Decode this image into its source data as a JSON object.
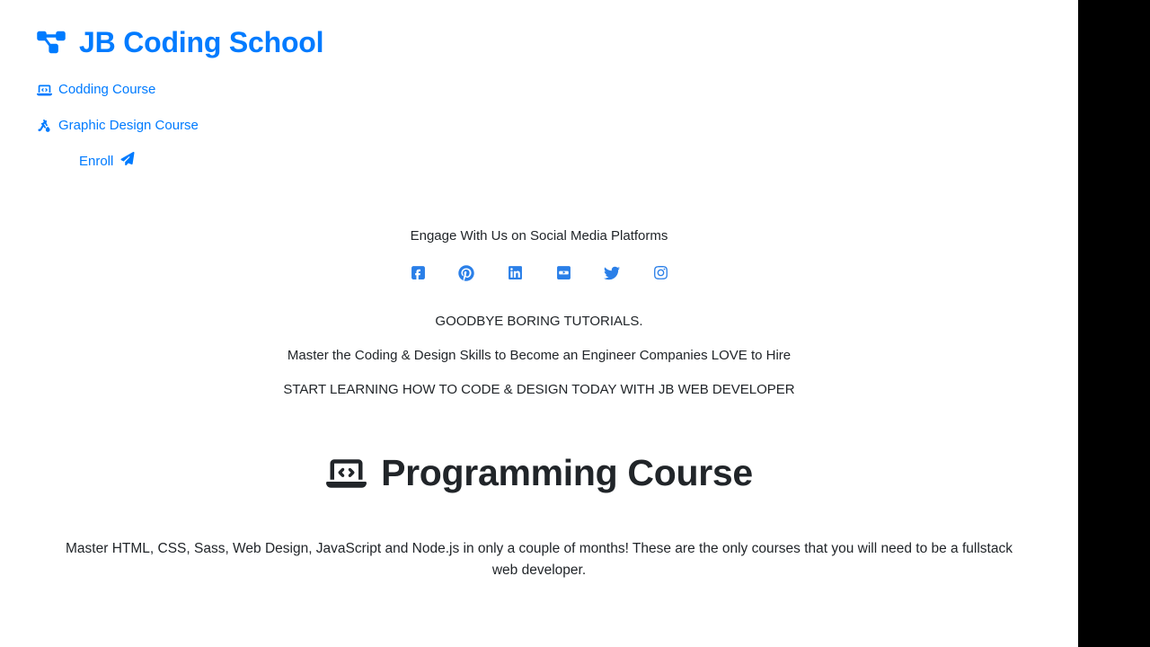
{
  "colors": {
    "brand_blue": "#007bff",
    "social_blue": "#2a7fe8",
    "text_dark": "#212529",
    "page_background": "#ffffff",
    "outside_background": "#000000"
  },
  "header": {
    "logo_icon": "diagram-project-icon",
    "brand_title": "JB Coding School",
    "nav": [
      {
        "label": "Codding Course",
        "icon": "laptop-code-icon"
      },
      {
        "label": "Graphic Design Course",
        "icon": "drafting-compass-icon"
      }
    ],
    "enroll": {
      "label": "Enroll",
      "icon": "paper-plane-icon"
    }
  },
  "social": {
    "heading": "Engage With Us on Social Media Platforms",
    "platforms": [
      {
        "name": "Facebook",
        "icon": "facebook-icon"
      },
      {
        "name": "Pinterest",
        "icon": "pinterest-icon"
      },
      {
        "name": "LinkedIn",
        "icon": "linkedin-icon"
      },
      {
        "name": "YouTube",
        "icon": "youtube-icon"
      },
      {
        "name": "Twitter",
        "icon": "twitter-icon"
      },
      {
        "name": "Instagram",
        "icon": "instagram-icon"
      }
    ]
  },
  "taglines": [
    "GOODBYE BORING TUTORIALS.",
    "Master the Coding & Design Skills to Become an Engineer Companies LOVE to Hire",
    "START LEARNING HOW TO CODE & DESIGN TODAY WITH JB WEB DEVELOPER"
  ],
  "course": {
    "icon": "laptop-code-icon",
    "title": "Programming Course",
    "description": "Master HTML, CSS, Sass, Web Design, JavaScript and Node.js in only a couple of months! These are the only courses that you will need to be a fullstack web developer."
  }
}
